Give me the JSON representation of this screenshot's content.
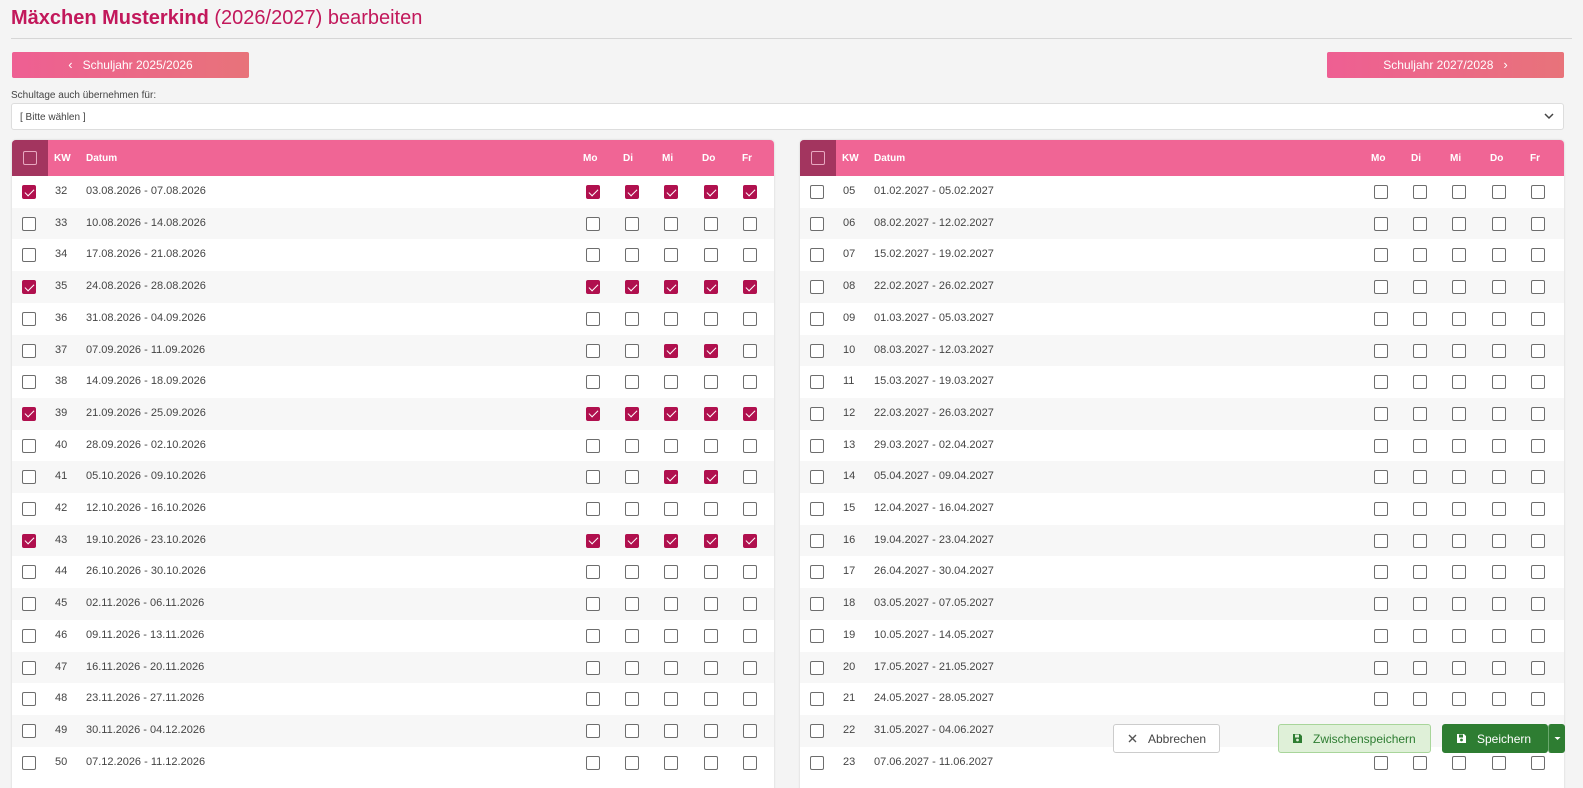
{
  "header": {
    "name": "Mäxchen Musterkind",
    "year": "(2026/2027)",
    "action": "bearbeiten"
  },
  "nav": {
    "prev_label": "Schuljahr 2025/2026",
    "next_label": "Schuljahr 2027/2028"
  },
  "apply_for": {
    "label": "Schultage auch übernehmen für:",
    "value": "[ Bitte wählen ]"
  },
  "columns": {
    "kw": "KW",
    "datum": "Datum",
    "days": [
      "Mo",
      "Di",
      "Mi",
      "Do",
      "Fr"
    ]
  },
  "left_weeks": [
    {
      "kw": "32",
      "datum": "03.08.2026 - 07.08.2026",
      "row": true,
      "days": [
        true,
        true,
        true,
        true,
        true
      ]
    },
    {
      "kw": "33",
      "datum": "10.08.2026 - 14.08.2026",
      "row": false,
      "days": [
        false,
        false,
        false,
        false,
        false
      ]
    },
    {
      "kw": "34",
      "datum": "17.08.2026 - 21.08.2026",
      "row": false,
      "days": [
        false,
        false,
        false,
        false,
        false
      ]
    },
    {
      "kw": "35",
      "datum": "24.08.2026 - 28.08.2026",
      "row": true,
      "days": [
        true,
        true,
        true,
        true,
        true
      ]
    },
    {
      "kw": "36",
      "datum": "31.08.2026 - 04.09.2026",
      "row": false,
      "days": [
        false,
        false,
        false,
        false,
        false
      ]
    },
    {
      "kw": "37",
      "datum": "07.09.2026 - 11.09.2026",
      "row": false,
      "days": [
        false,
        false,
        true,
        true,
        false
      ]
    },
    {
      "kw": "38",
      "datum": "14.09.2026 - 18.09.2026",
      "row": false,
      "days": [
        false,
        false,
        false,
        false,
        false
      ]
    },
    {
      "kw": "39",
      "datum": "21.09.2026 - 25.09.2026",
      "row": true,
      "days": [
        true,
        true,
        true,
        true,
        true
      ]
    },
    {
      "kw": "40",
      "datum": "28.09.2026 - 02.10.2026",
      "row": false,
      "days": [
        false,
        false,
        false,
        false,
        false
      ]
    },
    {
      "kw": "41",
      "datum": "05.10.2026 - 09.10.2026",
      "row": false,
      "days": [
        false,
        false,
        true,
        true,
        false
      ]
    },
    {
      "kw": "42",
      "datum": "12.10.2026 - 16.10.2026",
      "row": false,
      "days": [
        false,
        false,
        false,
        false,
        false
      ]
    },
    {
      "kw": "43",
      "datum": "19.10.2026 - 23.10.2026",
      "row": true,
      "days": [
        true,
        true,
        true,
        true,
        true
      ]
    },
    {
      "kw": "44",
      "datum": "26.10.2026 - 30.10.2026",
      "row": false,
      "days": [
        false,
        false,
        false,
        false,
        false
      ]
    },
    {
      "kw": "45",
      "datum": "02.11.2026 - 06.11.2026",
      "row": false,
      "days": [
        false,
        false,
        false,
        false,
        false
      ]
    },
    {
      "kw": "46",
      "datum": "09.11.2026 - 13.11.2026",
      "row": false,
      "days": [
        false,
        false,
        false,
        false,
        false
      ]
    },
    {
      "kw": "47",
      "datum": "16.11.2026 - 20.11.2026",
      "row": false,
      "days": [
        false,
        false,
        false,
        false,
        false
      ]
    },
    {
      "kw": "48",
      "datum": "23.11.2026 - 27.11.2026",
      "row": false,
      "days": [
        false,
        false,
        false,
        false,
        false
      ]
    },
    {
      "kw": "49",
      "datum": "30.11.2026 - 04.12.2026",
      "row": false,
      "days": [
        false,
        false,
        false,
        false,
        false
      ]
    },
    {
      "kw": "50",
      "datum": "07.12.2026 - 11.12.2026",
      "row": false,
      "days": [
        false,
        false,
        false,
        false,
        false
      ]
    }
  ],
  "right_weeks": [
    {
      "kw": "05",
      "datum": "01.02.2027 - 05.02.2027",
      "row": false,
      "days": [
        false,
        false,
        false,
        false,
        false
      ]
    },
    {
      "kw": "06",
      "datum": "08.02.2027 - 12.02.2027",
      "row": false,
      "days": [
        false,
        false,
        false,
        false,
        false
      ]
    },
    {
      "kw": "07",
      "datum": "15.02.2027 - 19.02.2027",
      "row": false,
      "days": [
        false,
        false,
        false,
        false,
        false
      ]
    },
    {
      "kw": "08",
      "datum": "22.02.2027 - 26.02.2027",
      "row": false,
      "days": [
        false,
        false,
        false,
        false,
        false
      ]
    },
    {
      "kw": "09",
      "datum": "01.03.2027 - 05.03.2027",
      "row": false,
      "days": [
        false,
        false,
        false,
        false,
        false
      ]
    },
    {
      "kw": "10",
      "datum": "08.03.2027 - 12.03.2027",
      "row": false,
      "days": [
        false,
        false,
        false,
        false,
        false
      ]
    },
    {
      "kw": "11",
      "datum": "15.03.2027 - 19.03.2027",
      "row": false,
      "days": [
        false,
        false,
        false,
        false,
        false
      ]
    },
    {
      "kw": "12",
      "datum": "22.03.2027 - 26.03.2027",
      "row": false,
      "days": [
        false,
        false,
        false,
        false,
        false
      ]
    },
    {
      "kw": "13",
      "datum": "29.03.2027 - 02.04.2027",
      "row": false,
      "days": [
        false,
        false,
        false,
        false,
        false
      ]
    },
    {
      "kw": "14",
      "datum": "05.04.2027 - 09.04.2027",
      "row": false,
      "days": [
        false,
        false,
        false,
        false,
        false
      ]
    },
    {
      "kw": "15",
      "datum": "12.04.2027 - 16.04.2027",
      "row": false,
      "days": [
        false,
        false,
        false,
        false,
        false
      ]
    },
    {
      "kw": "16",
      "datum": "19.04.2027 - 23.04.2027",
      "row": false,
      "days": [
        false,
        false,
        false,
        false,
        false
      ]
    },
    {
      "kw": "17",
      "datum": "26.04.2027 - 30.04.2027",
      "row": false,
      "days": [
        false,
        false,
        false,
        false,
        false
      ]
    },
    {
      "kw": "18",
      "datum": "03.05.2027 - 07.05.2027",
      "row": false,
      "days": [
        false,
        false,
        false,
        false,
        false
      ]
    },
    {
      "kw": "19",
      "datum": "10.05.2027 - 14.05.2027",
      "row": false,
      "days": [
        false,
        false,
        false,
        false,
        false
      ]
    },
    {
      "kw": "20",
      "datum": "17.05.2027 - 21.05.2027",
      "row": false,
      "days": [
        false,
        false,
        false,
        false,
        false
      ]
    },
    {
      "kw": "21",
      "datum": "24.05.2027 - 28.05.2027",
      "row": false,
      "days": [
        false,
        false,
        false,
        false,
        false
      ]
    },
    {
      "kw": "22",
      "datum": "31.05.2027 - 04.06.2027",
      "row": false,
      "days": [
        false,
        false,
        false,
        false,
        false
      ]
    },
    {
      "kw": "23",
      "datum": "07.06.2027 - 11.06.2027",
      "row": false,
      "days": [
        false,
        false,
        false,
        false,
        false
      ]
    }
  ],
  "actions": {
    "cancel": "Abbrechen",
    "interim": "Zwischenspeichern",
    "save": "Speichern"
  },
  "icons": {
    "prev": "chevron-left-icon",
    "next": "chevron-right-icon",
    "caret": "chevron-down-icon",
    "cancel": "close-icon",
    "save": "floppy-disk-icon",
    "dropdown": "caret-down-icon"
  },
  "colors": {
    "brand": "#c2185b",
    "header_bg": "#f06595",
    "checked": "#b0104e",
    "save_green": "#2e7d32"
  }
}
